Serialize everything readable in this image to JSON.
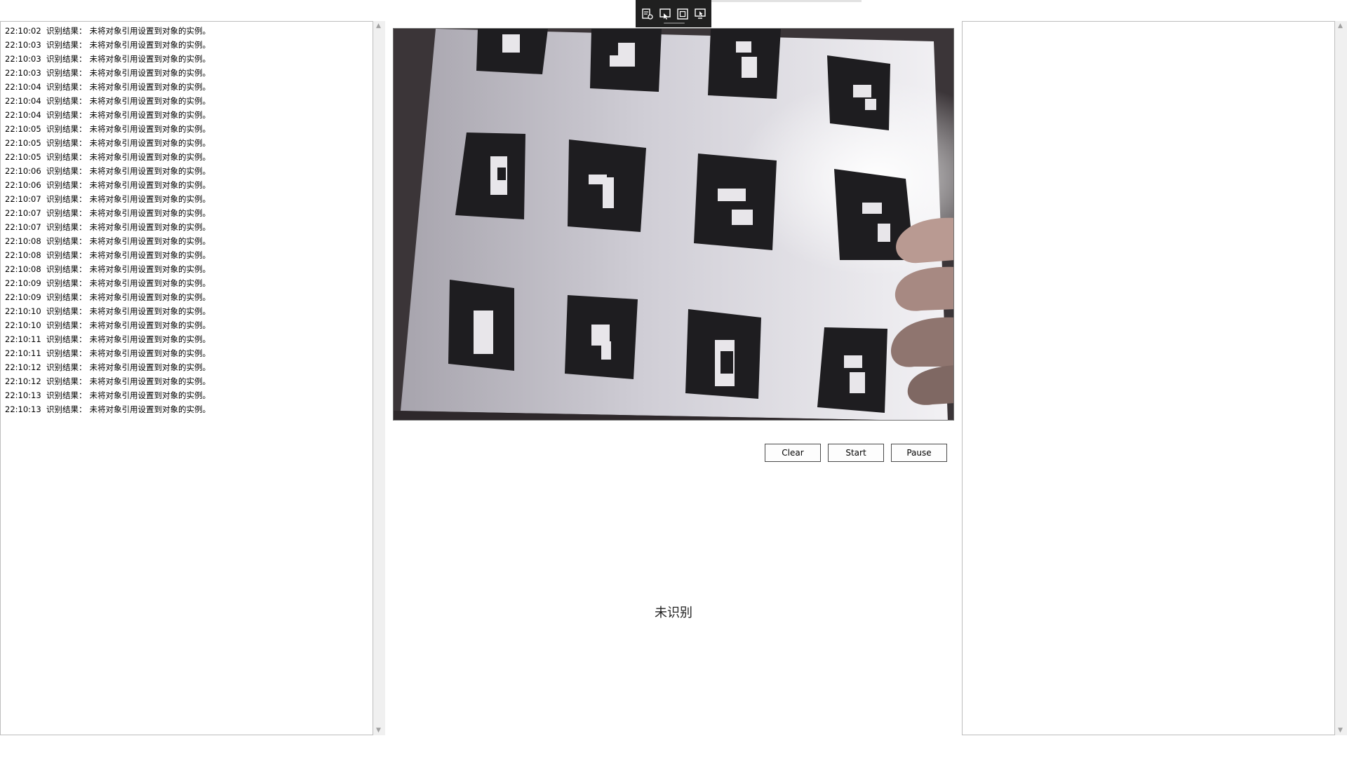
{
  "toolbar": {
    "icons": [
      "list-settings-icon",
      "window-capture-icon",
      "region-capture-icon",
      "screen-capture-icon"
    ]
  },
  "log": {
    "label": "识别结果：",
    "message": "未将对象引用设置到对象的实例。",
    "entries": [
      {
        "time": "22:10:02"
      },
      {
        "time": "22:10:03"
      },
      {
        "time": "22:10:03"
      },
      {
        "time": "22:10:03"
      },
      {
        "time": "22:10:04"
      },
      {
        "time": "22:10:04"
      },
      {
        "time": "22:10:04"
      },
      {
        "time": "22:10:05"
      },
      {
        "time": "22:10:05"
      },
      {
        "time": "22:10:05"
      },
      {
        "time": "22:10:06"
      },
      {
        "time": "22:10:06"
      },
      {
        "time": "22:10:07"
      },
      {
        "time": "22:10:07"
      },
      {
        "time": "22:10:07"
      },
      {
        "time": "22:10:08"
      },
      {
        "time": "22:10:08"
      },
      {
        "time": "22:10:08"
      },
      {
        "time": "22:10:09"
      },
      {
        "time": "22:10:09"
      },
      {
        "time": "22:10:10"
      },
      {
        "time": "22:10:10"
      },
      {
        "time": "22:10:11"
      },
      {
        "time": "22:10:11"
      },
      {
        "time": "22:10:12"
      },
      {
        "time": "22:10:12"
      },
      {
        "time": "22:10:13"
      },
      {
        "time": "22:10:13"
      }
    ]
  },
  "buttons": {
    "clear": "Clear",
    "start": "Start",
    "pause": "Pause"
  },
  "status": {
    "text": "未识别"
  }
}
